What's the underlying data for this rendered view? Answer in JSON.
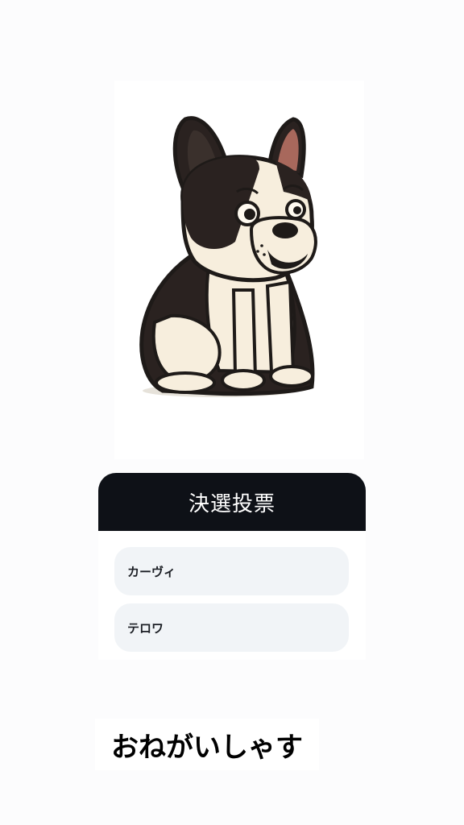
{
  "image": {
    "subject": "french-bulldog-illustration"
  },
  "poll": {
    "title": "決選投票",
    "options": [
      {
        "label": "カーヴィ"
      },
      {
        "label": "テロワ"
      }
    ]
  },
  "caption": {
    "text": "おねがいしゃす"
  },
  "colors": {
    "background": "#fcfcfd",
    "poll_header": "#0e1117",
    "option_bg": "#f1f4f7",
    "dog_dark": "#1e1a18",
    "dog_cream": "#f7eedd",
    "ear_inner": "#a8685c"
  }
}
